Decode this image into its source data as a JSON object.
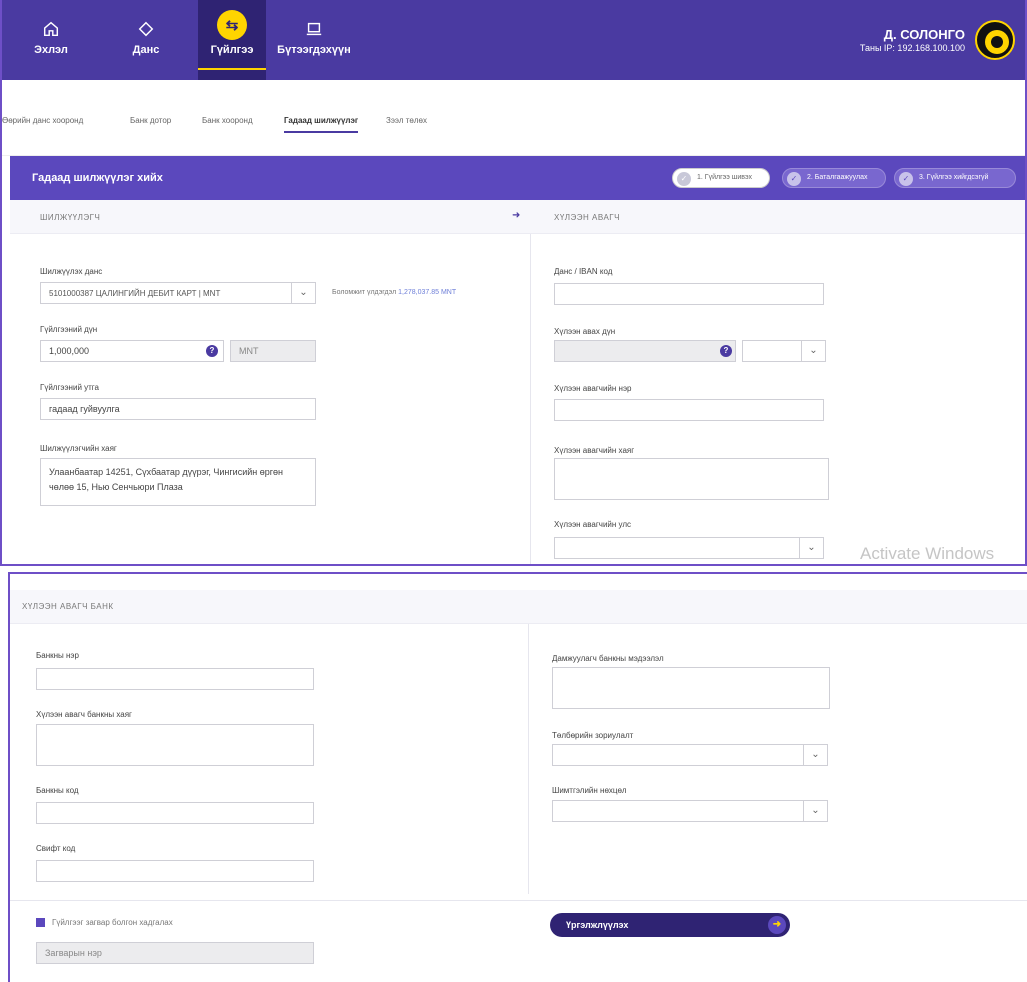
{
  "nav": {
    "home": "Эхлэл",
    "account": "Данс",
    "transfer": "Гүйлгээ",
    "products": "Бүтээгдэхүүн"
  },
  "user": {
    "name": "Д. СОЛОНГО",
    "ip": "Таны IP: 192.168.100.100"
  },
  "subtabs": [
    "Өөрийн данс хооронд",
    "Банк дотор",
    "Банк хооронд",
    "Гадаад шилжүүлэг",
    "Зээл төлөх"
  ],
  "form": {
    "title": "Гадаад шилжүүлэг хийх",
    "steps": [
      "1. Гүйлгээ шивэх",
      "2. Баталгаажуулах",
      "3. Гүйлгээ хийгдсэгүй"
    ]
  },
  "sender": {
    "section": "ШИЛЖҮҮЛЭГЧ",
    "account_label": "Шилжүүлэх данс",
    "account_value": "5101000387 ЦАЛИНГИЙН ДЕБИТ КАРТ | MNT",
    "balance_label": "Боломжит үлдэгдэл",
    "balance_value": "1,278,037.85 MNT",
    "amount_label": "Гүйлгээний дүн",
    "amount_value": "1,000,000",
    "currency": "MNT",
    "purpose_label": "Гүйлгээний утга",
    "purpose_value": "гадаад гуйвуулга",
    "address_label": "Шилжүүлэгчийн хаяг",
    "address_line1": "Улаанбаатар 14251, Сүхбаатар дүүрэг, Чингисийн өргөн",
    "address_line2": "чөлөө 15, Нью Сенчьюри Плаза"
  },
  "receiver": {
    "section": "ХҮЛЭЭН АВАГЧ",
    "iban_label": "Данс / IBAN код",
    "amount_label": "Хүлээн авах дүн",
    "name_label": "Хүлээн авагчийн нэр",
    "address_label": "Хүлээн авагчийн хаяг",
    "country_label": "Хүлээн авагчийн улс"
  },
  "watermark": "Activate Windows",
  "bank": {
    "section": "ХҮЛЭЭН АВАГЧ БАНК",
    "name_label": "Банкны нэр",
    "address_label": "Хүлээн авагч банкны хаяг",
    "code_label": "Банкны код",
    "swift_label": "Свифт код",
    "intermediary_label": "Дамжуулагч банкны мэдээлэл",
    "correspondent_label": "Төлбөрийн зориулалт",
    "fee_label": "Шимтгэлийн нөхцөл"
  },
  "template": {
    "checkbox_label": "Гүйлгээг загвар болгон хадгалах",
    "name_placeholder": "Загварын нэр"
  },
  "actions": {
    "continue": "Үргэлжлүүлэх"
  }
}
